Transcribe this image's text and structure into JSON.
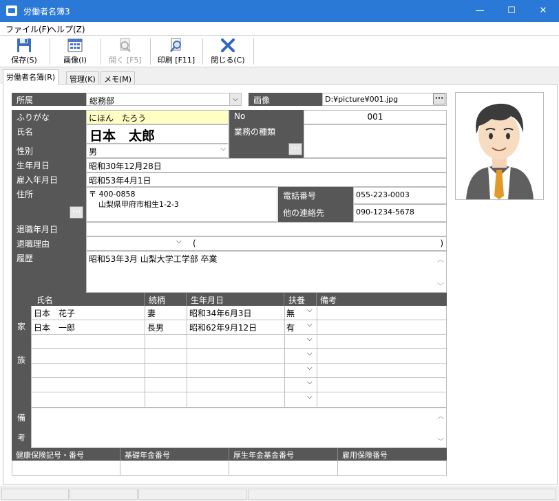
{
  "window": {
    "title": "労働者名簿3",
    "minimize": "—",
    "maximize": "☐",
    "close": "✕"
  },
  "menu": [
    {
      "label": "ファイル(F)"
    },
    {
      "label": "ヘルプ(Z)"
    }
  ],
  "toolbar": {
    "save": "保存(S)",
    "image": "画像(I)",
    "open": "開く [F5]",
    "print": "印刷 [F11]",
    "close": "閉じる(C)"
  },
  "tabs": [
    {
      "label": "労働者名簿(R)"
    },
    {
      "label": "管理(K)"
    },
    {
      "label": "メモ(M)"
    }
  ],
  "form": {
    "dept_label": "所属",
    "dept_value": "総務部",
    "image_label": "画像",
    "image_path": "D:¥picture¥001.jpg",
    "furigana_label": "ふりがな",
    "furigana_value": "にほん　たろう",
    "no_label": "No",
    "no_value": "001",
    "name_label": "氏名",
    "name_value": "日本　太郎",
    "job_label": "業務の種類",
    "job_value": "",
    "gender_label": "性別",
    "gender_value": "男",
    "birth_label": "生年月日",
    "birth_value": "昭和30年12月28日",
    "hire_label": "雇入年月日",
    "hire_value": "昭和53年4月1日",
    "address_label": "住所",
    "postal": "〒 400-0858",
    "address": "山梨県甲府市相生1-2-3",
    "phone_label": "電話番号",
    "phone_value": "055-223-0003",
    "other_label": "他の連絡先",
    "other_value": "090-1234-5678",
    "retire_date_label": "退職年月日",
    "retire_date_value": "",
    "retire_reason_label": "退職理由",
    "retire_paren_open": "(",
    "retire_paren_close": ")",
    "history_label": "履歴",
    "history_value": "昭和53年3月 山梨大学工学部 卒業"
  },
  "family": {
    "side_label_1": "家",
    "side_label_2": "族",
    "headers": {
      "name": "氏名",
      "relation": "続柄",
      "birth": "生年月日",
      "support": "扶養",
      "note": "備考"
    },
    "rows": [
      {
        "name": "日本　花子",
        "relation": "妻",
        "birth": "昭和34年6月3日",
        "support": "無",
        "note": ""
      },
      {
        "name": "日本　一郎",
        "relation": "長男",
        "birth": "昭和62年9月12日",
        "support": "有",
        "note": ""
      },
      {
        "name": "",
        "relation": "",
        "birth": "",
        "support": "",
        "note": ""
      },
      {
        "name": "",
        "relation": "",
        "birth": "",
        "support": "",
        "note": ""
      },
      {
        "name": "",
        "relation": "",
        "birth": "",
        "support": "",
        "note": ""
      },
      {
        "name": "",
        "relation": "",
        "birth": "",
        "support": "",
        "note": ""
      },
      {
        "name": "",
        "relation": "",
        "birth": "",
        "support": "",
        "note": ""
      }
    ]
  },
  "remarks": {
    "label_1": "備",
    "label_2": "考",
    "value": ""
  },
  "insurance": {
    "health": "健康保険記号・番号",
    "pension": "基礎年金番号",
    "fund": "厚生年金基金番号",
    "employment": "雇用保険番号"
  },
  "colors": {
    "titlebar": "#2b79d6",
    "label_bg": "#575757",
    "furigana_bg": "#ffffc4"
  }
}
